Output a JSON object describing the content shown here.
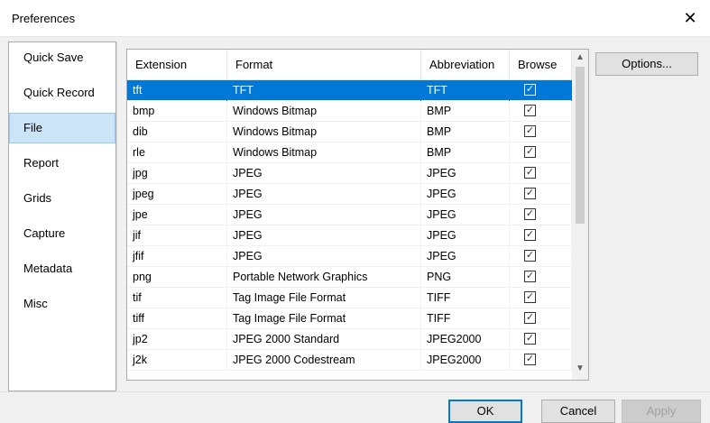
{
  "window": {
    "title": "Preferences"
  },
  "sidebar": {
    "items": [
      {
        "label": "Quick Save",
        "selected": false
      },
      {
        "label": "Quick Record",
        "selected": false
      },
      {
        "label": "File",
        "selected": true
      },
      {
        "label": "Report",
        "selected": false
      },
      {
        "label": "Grids",
        "selected": false
      },
      {
        "label": "Capture",
        "selected": false
      },
      {
        "label": "Metadata",
        "selected": false
      },
      {
        "label": "Misc",
        "selected": false
      }
    ]
  },
  "table": {
    "columns": [
      "Extension",
      "Format",
      "Abbreviation",
      "Browse"
    ],
    "rows": [
      {
        "ext": "tft",
        "format": "TFT",
        "abbr": "TFT",
        "browse": true,
        "selected": true
      },
      {
        "ext": "bmp",
        "format": "Windows Bitmap",
        "abbr": "BMP",
        "browse": true
      },
      {
        "ext": "dib",
        "format": "Windows Bitmap",
        "abbr": "BMP",
        "browse": true
      },
      {
        "ext": "rle",
        "format": "Windows Bitmap",
        "abbr": "BMP",
        "browse": true
      },
      {
        "ext": "jpg",
        "format": "JPEG",
        "abbr": "JPEG",
        "browse": true
      },
      {
        "ext": "jpeg",
        "format": "JPEG",
        "abbr": "JPEG",
        "browse": true
      },
      {
        "ext": "jpe",
        "format": "JPEG",
        "abbr": "JPEG",
        "browse": true
      },
      {
        "ext": "jif",
        "format": "JPEG",
        "abbr": "JPEG",
        "browse": true
      },
      {
        "ext": "jfif",
        "format": "JPEG",
        "abbr": "JPEG",
        "browse": true
      },
      {
        "ext": "png",
        "format": "Portable Network Graphics",
        "abbr": "PNG",
        "browse": true
      },
      {
        "ext": "tif",
        "format": "Tag Image File Format",
        "abbr": "TIFF",
        "browse": true
      },
      {
        "ext": "tiff",
        "format": "Tag Image File Format",
        "abbr": "TIFF",
        "browse": true
      },
      {
        "ext": "jp2",
        "format": "JPEG 2000 Standard",
        "abbr": "JPEG2000",
        "browse": true
      },
      {
        "ext": "j2k",
        "format": "JPEG 2000 Codestream",
        "abbr": "JPEG2000",
        "browse": true
      }
    ]
  },
  "buttons": {
    "options": "Options...",
    "ok": "OK",
    "cancel": "Cancel",
    "apply": "Apply"
  },
  "icons": {
    "close": "close-icon",
    "check": "checkmark-icon",
    "scroll_up": "chevron-up-icon",
    "scroll_down": "chevron-down-icon"
  },
  "colors": {
    "selection": "#0078d7",
    "sidebar_selected": "#cce4f7"
  }
}
